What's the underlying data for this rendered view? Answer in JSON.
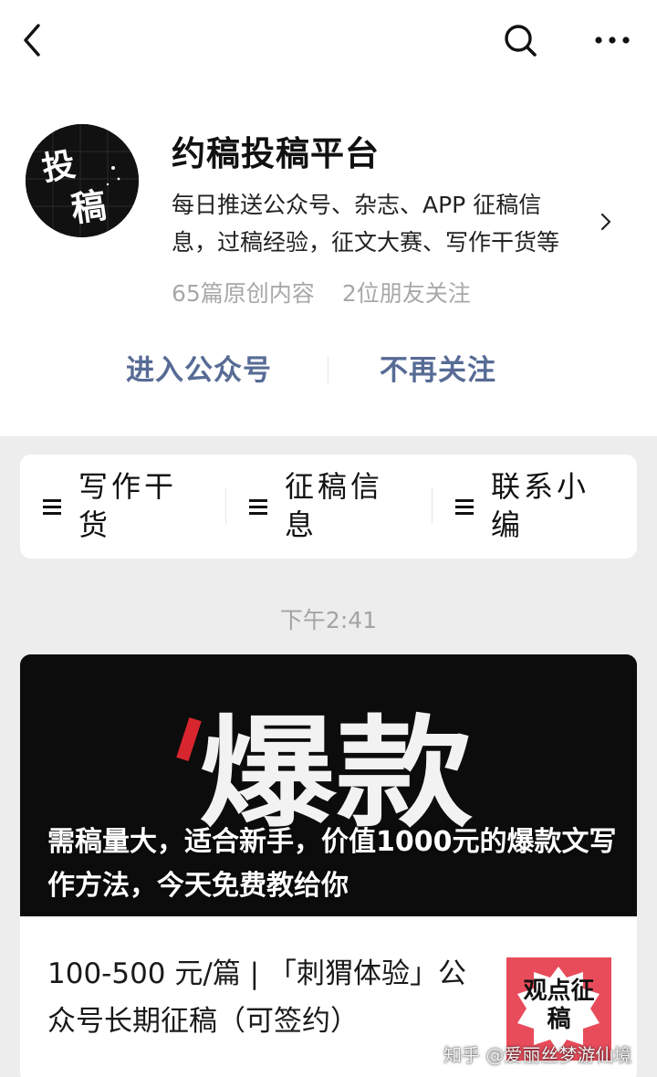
{
  "account": {
    "name": "约稿投稿平台",
    "avatar_text": "投稿",
    "description": "每日推送公众号、杂志、APP 征稿信息，过稿经验，征文大赛、写作干货等",
    "original_count": "65篇原创内容",
    "friends_following": "2位朋友关注"
  },
  "actions": {
    "enter": "进入公众号",
    "unfollow": "不再关注"
  },
  "menu": [
    {
      "label": "写作干货",
      "icon": "menu-lines-icon"
    },
    {
      "label": "征稿信息",
      "icon": "menu-lines-icon"
    },
    {
      "label": "联系小编",
      "icon": "menu-lines-icon"
    }
  ],
  "timestamp": "下午2:41",
  "article": {
    "cover_text": "爆款",
    "title": "需稿量大，适合新手，价值1000元的爆款文写作方法，今天免费教给你",
    "sub_title": "100-500 元/篇 | 「刺猬体验」公众号长期征稿（可签约）",
    "thumb_text": "观点征稿"
  },
  "watermark": "知乎 @爱丽丝梦游仙境",
  "colors": {
    "link": "#576b95",
    "background": "#ededed",
    "thumb_bg": "#e84c5b"
  }
}
